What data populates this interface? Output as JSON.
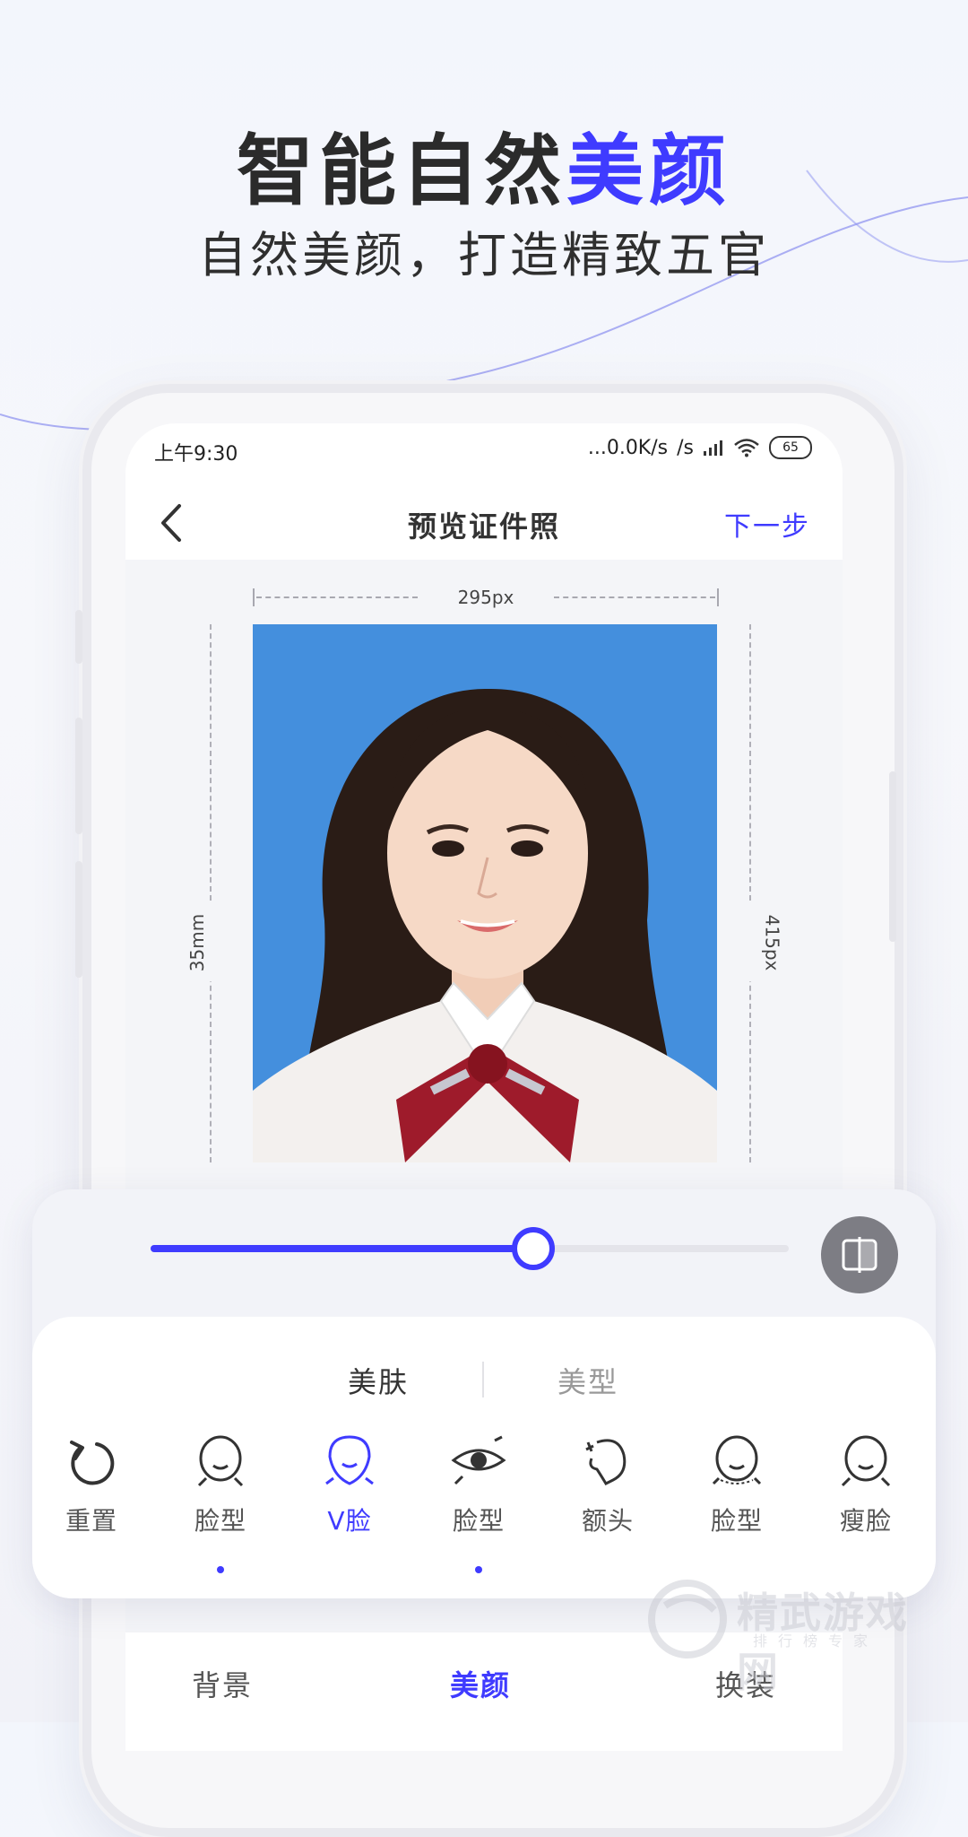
{
  "hero": {
    "title_main": "智能自然",
    "title_accent": "美颜",
    "subtitle": "自然美颜，打造精致五官"
  },
  "status_bar": {
    "time": "上午9:30",
    "network": "...0.0K/s",
    "battery": "65"
  },
  "navbar": {
    "title": "预览证件照",
    "next_label": "下一步"
  },
  "preview": {
    "width_label": "295px",
    "height_mm_label": "35mm",
    "height_px_label": "415px"
  },
  "beauty": {
    "slider_level": 0.6,
    "segments": [
      "美肤",
      "美型"
    ],
    "active_segment": 0,
    "tools": [
      {
        "label": "重置",
        "icon": "reset-icon"
      },
      {
        "label": "脸型",
        "icon": "face-shape-icon",
        "dot": true
      },
      {
        "label": "V脸",
        "icon": "v-face-icon",
        "active": true
      },
      {
        "label": "脸型",
        "icon": "eye-icon",
        "dot": true
      },
      {
        "label": "额头",
        "icon": "forehead-icon"
      },
      {
        "label": "脸型",
        "icon": "face-narrow-icon"
      },
      {
        "label": "瘦脸",
        "icon": "slim-face-icon"
      }
    ]
  },
  "bottom_tabs": [
    {
      "label": "背景"
    },
    {
      "label": "美颜",
      "active": true
    },
    {
      "label": "换装"
    }
  ],
  "watermark": {
    "text": "精武游戏网",
    "sub": "排行榜专家"
  },
  "colors": {
    "accent": "#3f3bff",
    "photo_bg": "#448fdd"
  }
}
